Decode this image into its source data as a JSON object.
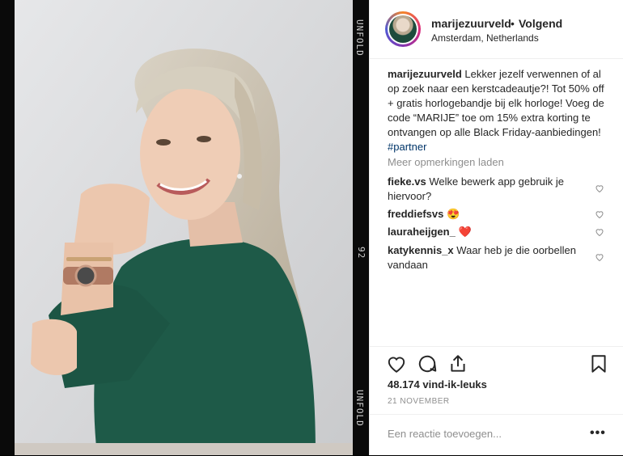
{
  "post": {
    "username": "marijezuurveld",
    "separator": "•",
    "follow_label": "Volgend",
    "location": "Amsterdam, Netherlands"
  },
  "caption": {
    "author": "marijezuurveld",
    "text": "Lekker jezelf verwennen of al op zoek naar een kerstcadeautje?! Tot 50% off + gratis horlogebandje bij elk horloge! Voeg de code “MARIJE” toe om 15% extra korting te ontvangen op alle Black Friday-aanbiedingen!",
    "hashtag": "#partner"
  },
  "more_comments_label": "Meer opmerkingen laden",
  "comments": [
    {
      "user": "fieke.vs",
      "text": "Welke bewerk app gebruik je hiervoor?"
    },
    {
      "user": "freddiefsvs",
      "text": "😍"
    },
    {
      "user": "lauraheijgen_",
      "text": "❤️"
    },
    {
      "user": "katykennis_x",
      "text": "Waar heb je die oorbellen vandaan"
    }
  ],
  "likes": "48.174 vind-ik-leuks",
  "date": "21 NOVEMBER",
  "comment_input": {
    "placeholder": "Een reactie toevoegen..."
  },
  "more_options": "•••",
  "film_strip": {
    "top_text": "UNFOLD",
    "frame_number": "92",
    "bottom_text": "UNFOLD"
  },
  "icons": [
    "heart-icon",
    "comment-icon",
    "share-icon",
    "bookmark-icon",
    "more-options-icon"
  ]
}
